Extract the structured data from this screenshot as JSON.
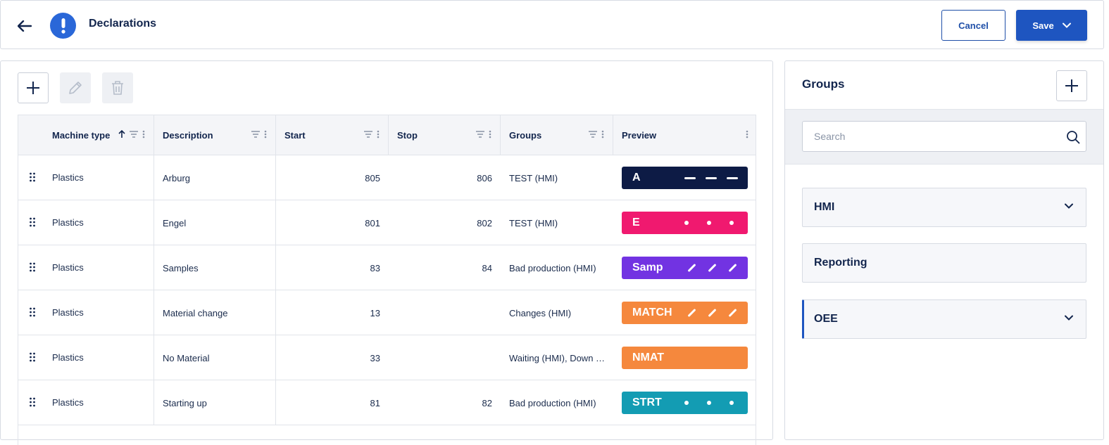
{
  "header": {
    "title": "Declarations",
    "cancel_label": "Cancel",
    "save_label": "Save"
  },
  "table": {
    "columns": [
      {
        "label": "Machine type",
        "sorted": "asc"
      },
      {
        "label": "Description"
      },
      {
        "label": "Start"
      },
      {
        "label": "Stop"
      },
      {
        "label": "Groups"
      },
      {
        "label": "Preview"
      }
    ],
    "rows": [
      {
        "machine_type": "Plastics",
        "description": "Arburg",
        "start": "805",
        "stop": "806",
        "groups": "TEST (HMI)",
        "preview": {
          "text": "A",
          "color": "#0d1b45",
          "marks": "dash"
        }
      },
      {
        "machine_type": "Plastics",
        "description": "Engel",
        "start": "801",
        "stop": "802",
        "groups": "TEST (HMI)",
        "preview": {
          "text": "E",
          "color": "#f0196f",
          "marks": "dot"
        }
      },
      {
        "machine_type": "Plastics",
        "description": "Samples",
        "start": "83",
        "stop": "84",
        "groups": "Bad production (HMI)",
        "preview": {
          "text": "Samp",
          "color": "#7233e2",
          "marks": "slash"
        }
      },
      {
        "machine_type": "Plastics",
        "description": "Material change",
        "start": "13",
        "stop": "",
        "groups": "Changes (HMI)",
        "preview": {
          "text": "MATCH",
          "color": "#f5883d",
          "marks": "slash"
        }
      },
      {
        "machine_type": "Plastics",
        "description": "No Material",
        "start": "33",
        "stop": "",
        "groups": "Waiting (HMI), Down …",
        "preview": {
          "text": "NMAT",
          "color": "#f5883d",
          "marks": "none"
        }
      },
      {
        "machine_type": "Plastics",
        "description": "Starting up",
        "start": "81",
        "stop": "82",
        "groups": "Bad production (HMI)",
        "preview": {
          "text": "STRT",
          "color": "#139cb3",
          "marks": "dot"
        }
      }
    ]
  },
  "groups_panel": {
    "title": "Groups",
    "search_placeholder": "Search",
    "items": [
      {
        "label": "HMI",
        "expandable": true,
        "active": false
      },
      {
        "label": "Reporting",
        "expandable": false,
        "active": false
      },
      {
        "label": "OEE",
        "expandable": true,
        "active": true
      }
    ]
  },
  "colors": {
    "accent": "#1e55c0",
    "title_text": "#12254d"
  }
}
